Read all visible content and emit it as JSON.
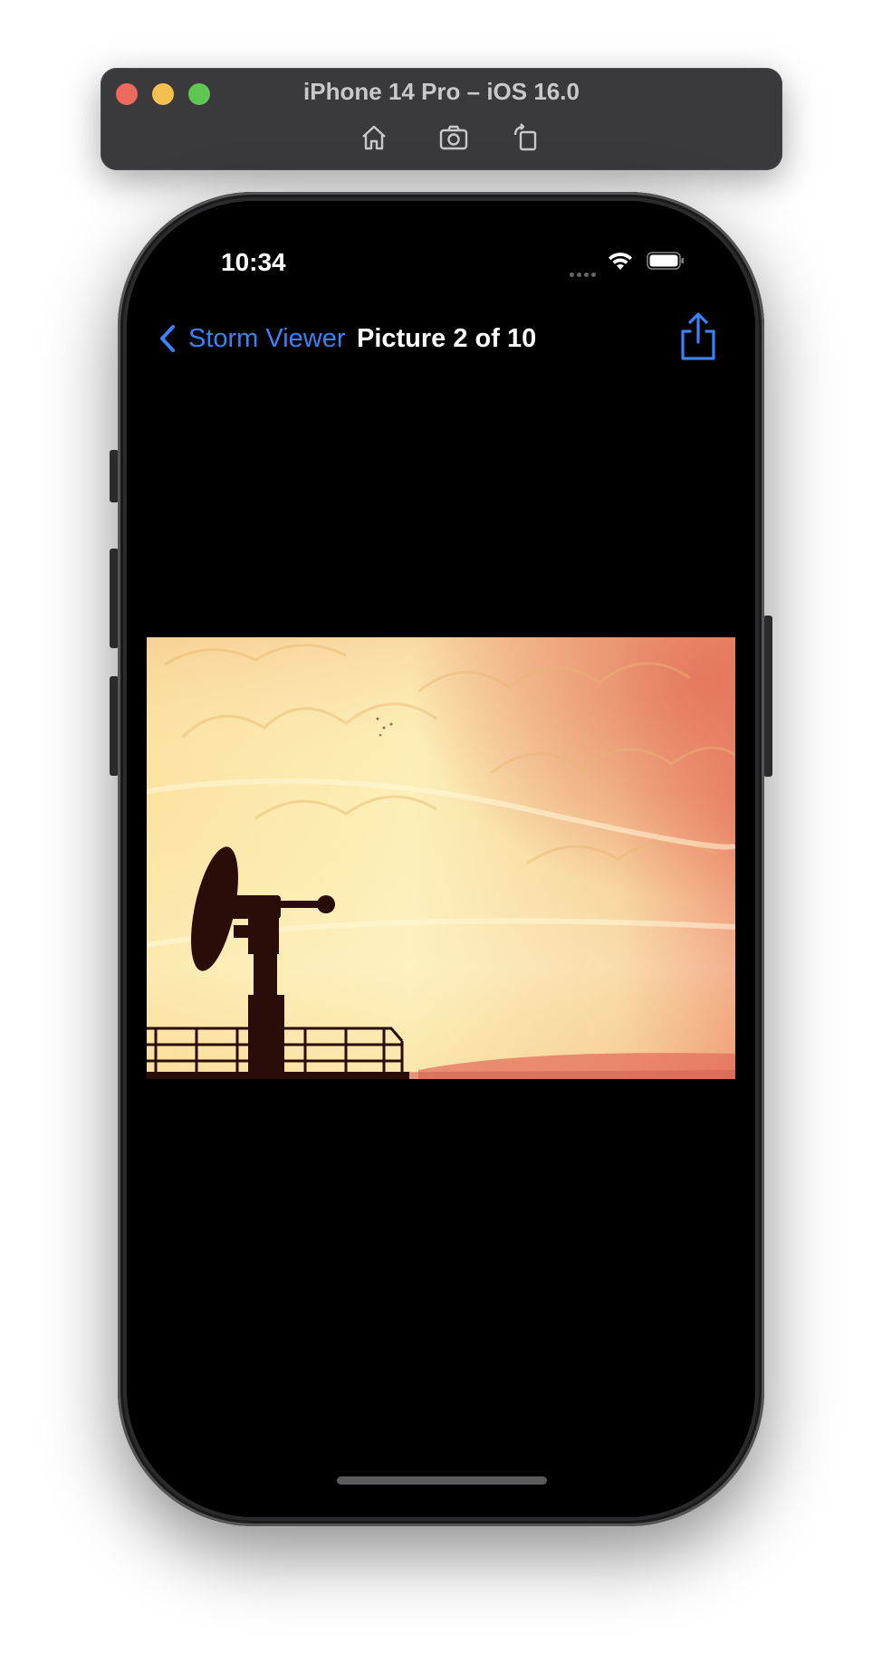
{
  "simulator": {
    "title": "iPhone 14 Pro – iOS 16.0",
    "tools": [
      "home-icon",
      "screenshot-icon",
      "rotate-icon"
    ]
  },
  "status_bar": {
    "time": "10:34"
  },
  "nav": {
    "back_label": "Storm Viewer",
    "title": "Picture 2 of 10",
    "action_icon": "share-icon"
  },
  "colors": {
    "accent": "#3b82f6"
  }
}
